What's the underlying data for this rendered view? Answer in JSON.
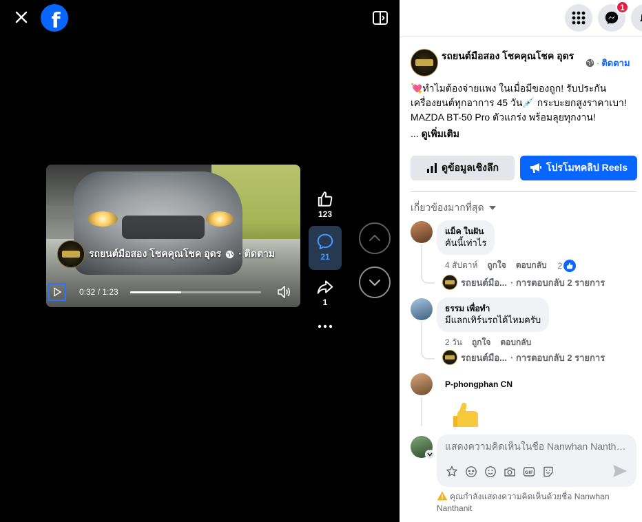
{
  "video": {
    "owner_name": "รถยนต์มือสอง โชคคุณโชค อุดร",
    "follow_label": "· ติดตาม",
    "time_text": "0:32 / 1:23",
    "progress_fraction": 0.39
  },
  "actions": {
    "like_count": "123",
    "comment_count": "21",
    "share_count": "1"
  },
  "topbar": {
    "messenger_badge": "1"
  },
  "post": {
    "author": "รถยนต์มือสอง โชคคุณโชค อุดร",
    "follow_label": "ติดตาม",
    "separator": "·",
    "text": "💘ทำไมต้องจ่ายแพง ในเมื่อมีของถูก! รับประกันเครื่องยนต์ทุกอาการ 45 วัน💉 กระบะยกสูงราคาเบา! MAZDA BT-50 Pro ตัวแกร่ง พร้อมลุยทุกงาน!",
    "ellipsis": "...",
    "see_more": "ดูเพิ่มเติม"
  },
  "buttons": {
    "insights": "ดูข้อมูลเชิงลึก",
    "promote": "โปรโมทคลิป Reels"
  },
  "comments": {
    "sort_label": "เกี่ยวข้องมากที่สุด",
    "items": [
      {
        "name": "แม็ค ในฝัน",
        "text": "คันนี้เท่าไร",
        "time": "4 สัปดาห์",
        "like": "ถูกใจ",
        "reply": "ตอบกลับ",
        "reactions": "2",
        "reply_author": "รถยนต์มือ...",
        "reply_count": "· การตอบกลับ 2 รายการ"
      },
      {
        "name": "ธรรม เพื่อทำ",
        "text": "มีแลกเทิร์นรถได้ไหมครับ",
        "time": "2 วัน",
        "like": "ถูกใจ",
        "reply": "ตอบกลับ",
        "reply_author": "รถยนต์มือ...",
        "reply_count": "· การตอบกลับ 2 รายการ"
      },
      {
        "name": "P-phongphan CN"
      }
    ]
  },
  "composer": {
    "placeholder": "แสดงความคิดเห็นในชื่อ Nanwhan Nanthanit",
    "notice": "คุณกำลังแสดงความคิดเห็นด้วยชื่อ Nanwhan Nanthanit"
  },
  "colors": {
    "accent": "#0866ff",
    "badge": "#e41e3f"
  }
}
